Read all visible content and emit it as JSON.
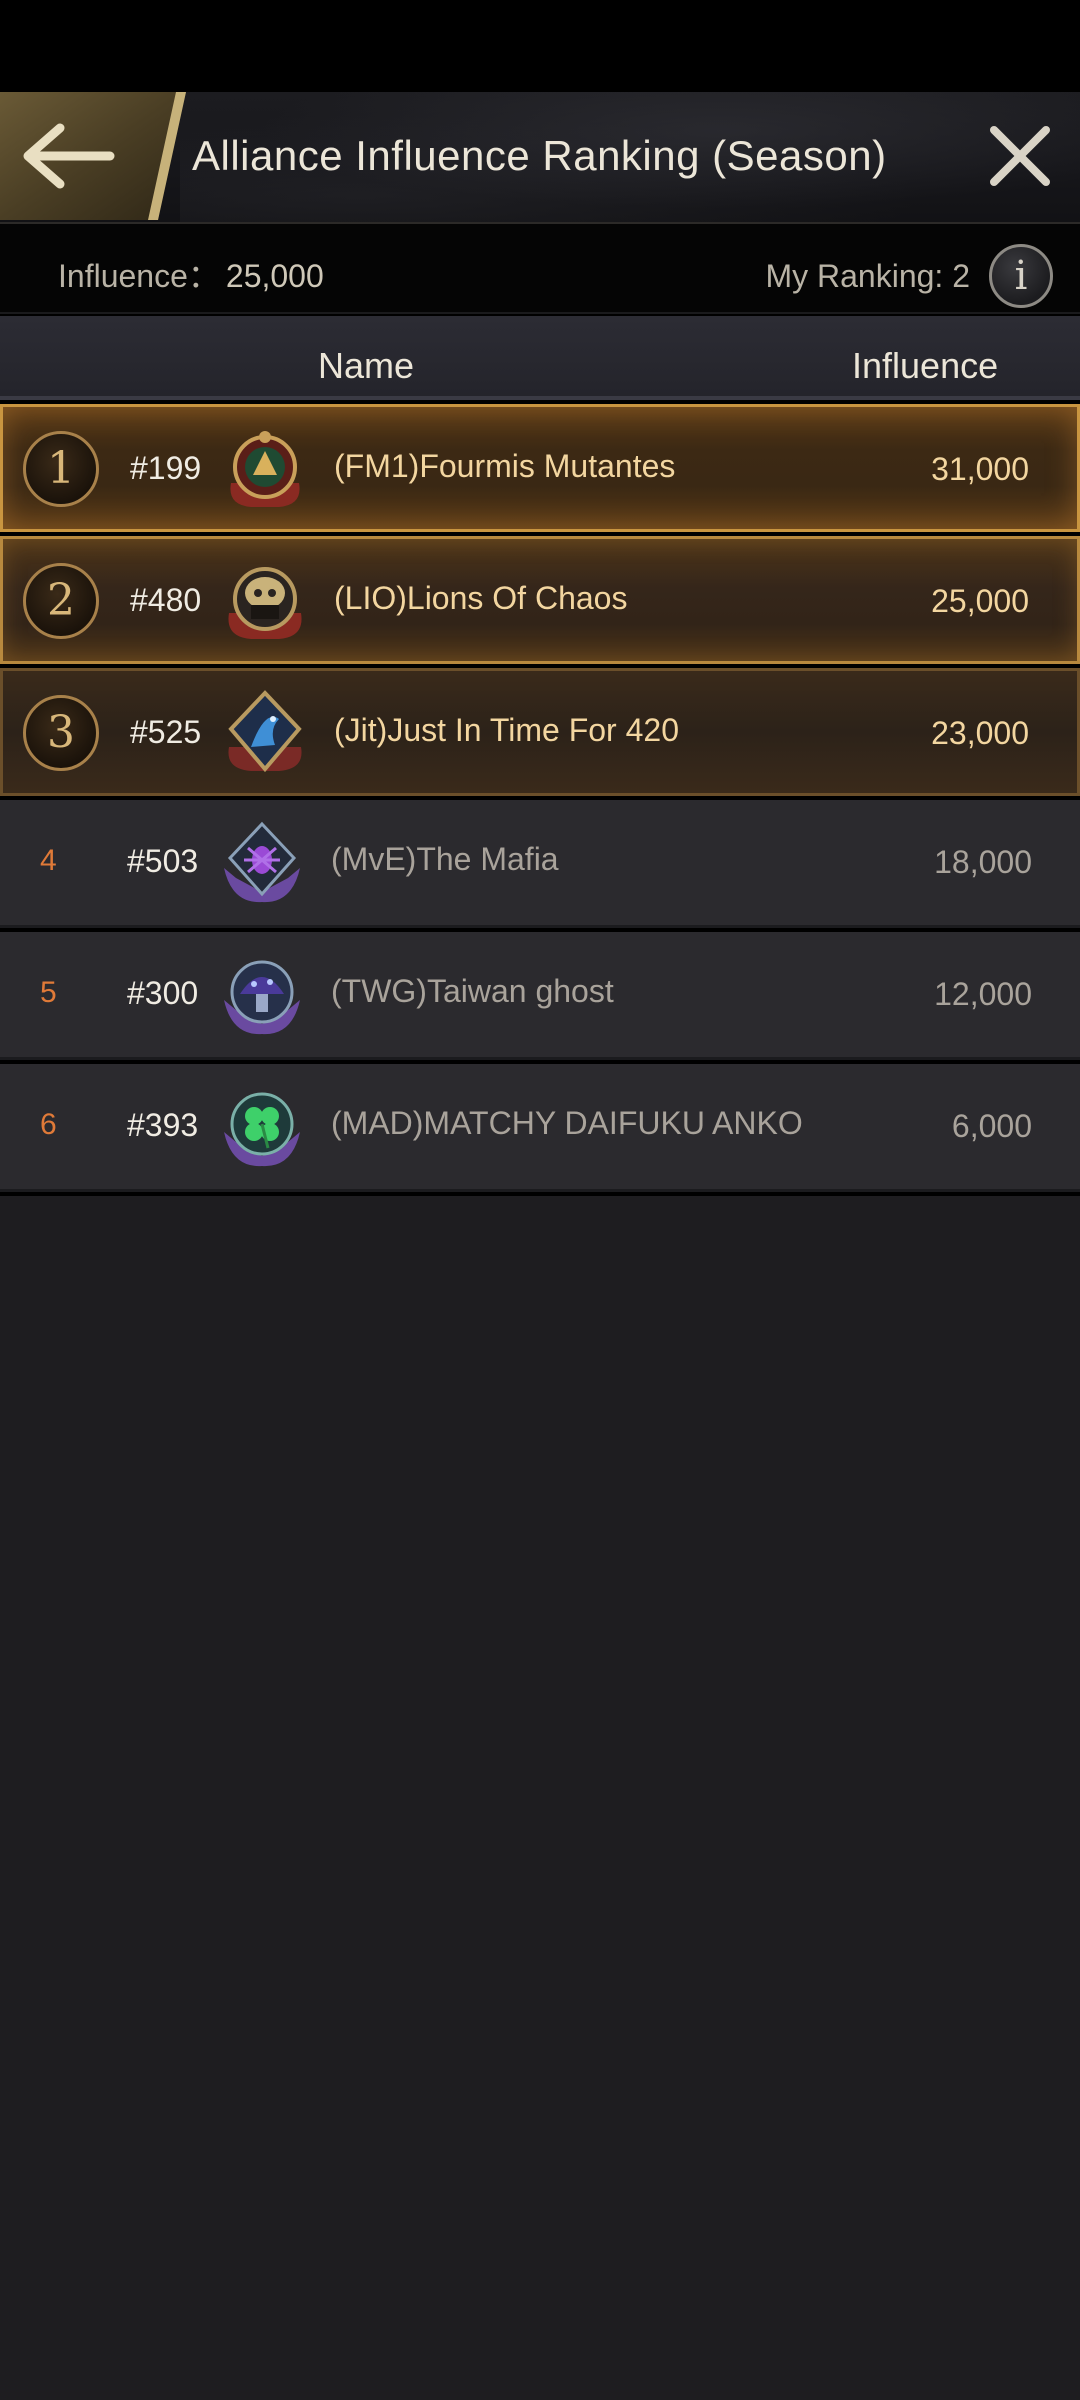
{
  "header": {
    "title": "Alliance Influence Ranking (Season)",
    "back_icon": "arrow-left-icon",
    "close_icon": "close-icon"
  },
  "summary": {
    "influence_label": "Influence：",
    "influence_value": "25,000",
    "my_ranking": "My Ranking: 2",
    "info_glyph": "i"
  },
  "columns": {
    "name": "Name",
    "influence": "Influence"
  },
  "rows": [
    {
      "rank": "1",
      "server": "#199",
      "name": "(FM1)Fourmis Mutantes",
      "influence": "31,000",
      "emblem": "red-gold-crest-icon"
    },
    {
      "rank": "2",
      "server": "#480",
      "name": "(LIO)Lions Of Chaos",
      "influence": "25,000",
      "emblem": "gold-skull-crest-icon"
    },
    {
      "rank": "3",
      "server": "#525",
      "name": "(Jit)Just In Time For 420",
      "influence": "23,000",
      "emblem": "blue-dragon-crest-icon"
    },
    {
      "rank": "4",
      "server": "#503",
      "name": "(MvE)The Mafia",
      "influence": "18,000",
      "emblem": "purple-spider-crest-icon"
    },
    {
      "rank": "5",
      "server": "#300",
      "name": "(TWG)Taiwan ghost",
      "influence": "12,000",
      "emblem": "purple-mushroom-crest-icon"
    },
    {
      "rank": "6",
      "server": "#393",
      "name": "(MAD)MATCHY DAIFUKU ANKO",
      "influence": "6,000",
      "emblem": "green-clover-crest-icon"
    }
  ],
  "colors": {
    "accent_gold": "#c99540",
    "rank_orange": "#e07a38",
    "background": "#1e1d20"
  }
}
